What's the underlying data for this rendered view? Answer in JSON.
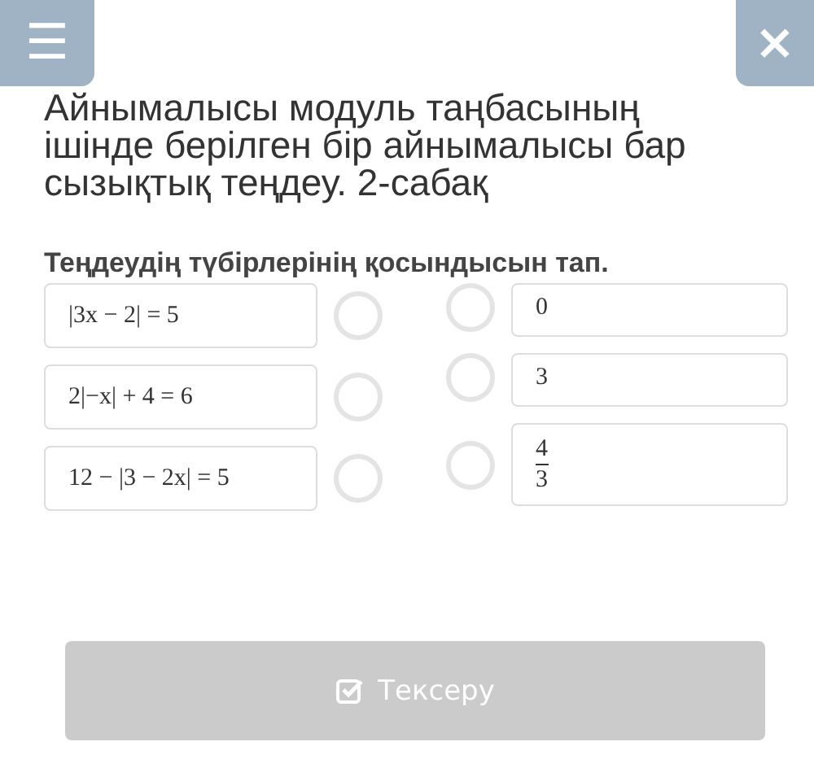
{
  "header": {
    "menu_icon": "☰",
    "close_icon": "×"
  },
  "title": "Айнымалысы модуль таңбасының ішінде берілген бір айнымалысы бар сызықтық теңдеу. 2-сабақ",
  "question": "Теңдеудің түбірлерінің қосындысын тап.",
  "equations": [
    {
      "kind": "equation",
      "text": "|3x − 2| = 5",
      "selected": false
    },
    {
      "kind": "equation",
      "text": "2|−x| + 4 = 6",
      "selected": false
    },
    {
      "kind": "equation",
      "text": "12 − |3 − 2x| = 5",
      "selected": false
    }
  ],
  "answers": [
    {
      "kind": "number",
      "text": "0",
      "selected": false
    },
    {
      "kind": "number",
      "text": "3",
      "selected": false
    },
    {
      "kind": "fraction",
      "numerator": "4",
      "denominator": "3",
      "selected": false
    }
  ],
  "check_button": {
    "label": "Тексеру",
    "disabled": true
  }
}
